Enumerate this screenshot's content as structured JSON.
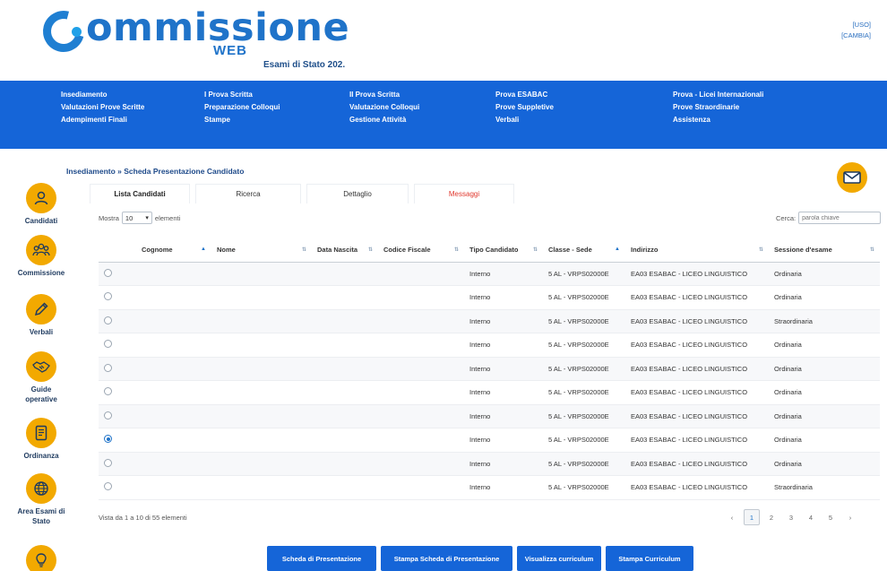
{
  "app": {
    "logo_text": "ommissione",
    "logo_sub": "WEB",
    "exam_title": "Esami di Stato 202.",
    "user_line1": "[USO]",
    "user_line2": "[CAMBIA]"
  },
  "colors": {
    "primary": "#1565d8",
    "accent": "#f2a900",
    "message": "#e0382e"
  },
  "nav": {
    "columns": [
      [
        "Insediamento",
        "Valutazioni Prove Scritte",
        "Adempimenti Finali"
      ],
      [
        "I Prova Scritta",
        "Preparazione Colloqui",
        "Stampe"
      ],
      [
        "II Prova Scritta",
        "Valutazione Colloqui",
        "Gestione Attività"
      ],
      [
        "Prova ESABAC",
        "Prove Suppletive",
        "Verbali"
      ],
      [
        "Prova - Licei Internazionali",
        "Prove Straordinarie",
        "Assistenza"
      ]
    ]
  },
  "breadcrumb": "Insediamento » Scheda Presentazione Candidato",
  "sidebar": {
    "items": [
      {
        "label": "Candidati",
        "icon": "user-icon"
      },
      {
        "label": "Commissione",
        "icon": "group-icon"
      },
      {
        "label": "Verbali",
        "icon": "pencil-icon"
      },
      {
        "label": "Guide operative",
        "icon": "handshake-icon"
      },
      {
        "label": "Ordinanza",
        "icon": "document-icon"
      },
      {
        "label": "Area Esami di Stato",
        "icon": "globe-icon"
      },
      {
        "label": "",
        "icon": "lightbulb-icon"
      }
    ]
  },
  "tabs": [
    "Lista Candidati",
    "Ricerca",
    "Dettaglio",
    "Messaggi"
  ],
  "controls": {
    "show_label": "Mostra",
    "show_value": "10",
    "show_suffix": "elementi",
    "search_label": "Cerca:",
    "search_placeholder": "parola chiave"
  },
  "table": {
    "headers": [
      "",
      "Cognome",
      "Nome",
      "Data Nascita",
      "Codice Fiscale",
      "Tipo Candidato",
      "Classe - Sede",
      "Indirizzo",
      "Sessione d'esame"
    ],
    "rows": [
      {
        "selected": false,
        "cognome": "",
        "nome": "",
        "data": "",
        "cf": "",
        "tipo": "Interno",
        "classe": "5 AL - VRPS02000E",
        "indirizzo": "EA03 ESABAC - LICEO LINGUISTICO",
        "sessione": "Ordinaria"
      },
      {
        "selected": false,
        "cognome": "",
        "nome": "",
        "data": "",
        "cf": "",
        "tipo": "Interno",
        "classe": "5 AL - VRPS02000E",
        "indirizzo": "EA03 ESABAC - LICEO LINGUISTICO",
        "sessione": "Ordinaria"
      },
      {
        "selected": false,
        "cognome": "",
        "nome": "",
        "data": "",
        "cf": "",
        "tipo": "Interno",
        "classe": "5 AL - VRPS02000E",
        "indirizzo": "EA03 ESABAC - LICEO LINGUISTICO",
        "sessione": "Straordinaria"
      },
      {
        "selected": false,
        "cognome": "",
        "nome": "",
        "data": "",
        "cf": "",
        "tipo": "Interno",
        "classe": "5 AL - VRPS02000E",
        "indirizzo": "EA03 ESABAC - LICEO LINGUISTICO",
        "sessione": "Ordinaria"
      },
      {
        "selected": false,
        "cognome": "",
        "nome": "",
        "data": "",
        "cf": "",
        "tipo": "Interno",
        "classe": "5 AL - VRPS02000E",
        "indirizzo": "EA03 ESABAC - LICEO LINGUISTICO",
        "sessione": "Ordinaria"
      },
      {
        "selected": false,
        "cognome": "",
        "nome": "",
        "data": "",
        "cf": "",
        "tipo": "Interno",
        "classe": "5 AL - VRPS02000E",
        "indirizzo": "EA03 ESABAC - LICEO LINGUISTICO",
        "sessione": "Ordinaria"
      },
      {
        "selected": false,
        "cognome": "",
        "nome": "",
        "data": "",
        "cf": "",
        "tipo": "Interno",
        "classe": "5 AL - VRPS02000E",
        "indirizzo": "EA03 ESABAC - LICEO LINGUISTICO",
        "sessione": "Ordinaria"
      },
      {
        "selected": true,
        "cognome": "",
        "nome": "",
        "data": "",
        "cf": "",
        "tipo": "Interno",
        "classe": "5 AL - VRPS02000E",
        "indirizzo": "EA03 ESABAC - LICEO LINGUISTICO",
        "sessione": "Ordinaria"
      },
      {
        "selected": false,
        "cognome": "",
        "nome": "",
        "data": "",
        "cf": "",
        "tipo": "Interno",
        "classe": "5 AL - VRPS02000E",
        "indirizzo": "EA03 ESABAC - LICEO LINGUISTICO",
        "sessione": "Ordinaria"
      },
      {
        "selected": false,
        "cognome": "",
        "nome": "",
        "data": "",
        "cf": "",
        "tipo": "Interno",
        "classe": "5 AL - VRPS02000E",
        "indirizzo": "EA03 ESABAC - LICEO LINGUISTICO",
        "sessione": "Straordinaria"
      }
    ]
  },
  "footer": {
    "info": "Vista da 1 a 10 di 55 elementi",
    "pages": [
      "‹",
      "1",
      "2",
      "3",
      "4",
      "5",
      "›"
    ],
    "active_page": "1"
  },
  "actions": [
    "Scheda di Presentazione",
    "Stampa Scheda di Presentazione",
    "Visualizza curriculum",
    "Stampa Curriculum"
  ]
}
